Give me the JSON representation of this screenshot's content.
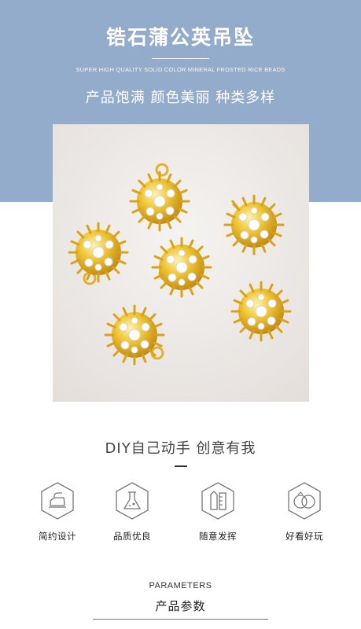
{
  "header": {
    "title": "锆石蒲公英吊坠",
    "subtitle_en": "SUPER HIGH QUALITY SOLID COLOR MINERAL FROSTED RICE BEADS",
    "tagline": "产品饱满 颜色美丽 种类多样",
    "background_color": "#94accb"
  },
  "photo": {
    "content": "product-photo-gold-dandelion-pendants"
  },
  "diy_section": {
    "title": "DIY自己动手 创意有我"
  },
  "features": [
    {
      "icon": "iron-icon",
      "label": "简约设计"
    },
    {
      "icon": "flask-icon",
      "label": "品质优良"
    },
    {
      "icon": "pen-ruler-icon",
      "label": "随意发挥"
    },
    {
      "icon": "rings-icon",
      "label": "好看好玩"
    }
  ],
  "parameters": {
    "title_en": "PARAMETERS",
    "title_cn": "产品参数"
  }
}
